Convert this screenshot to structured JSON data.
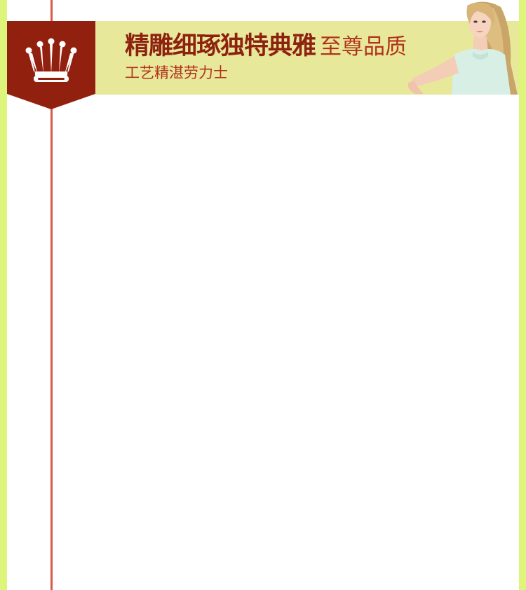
{
  "banner": {
    "headline_main": "精雕细琢独特典雅",
    "headline_sub": "至尊品质",
    "subline": "工艺精湛劳力士"
  },
  "icons": {
    "badge": "crown-icon",
    "photo": "model-photo"
  },
  "colors": {
    "side_border": "#ddf57a",
    "banner_bg": "#e8e89a",
    "badge_red": "#92200f",
    "headline_dark_red": "#8d2211",
    "accent_red": "#b2321e",
    "timeline_line": "#d65a4a"
  }
}
